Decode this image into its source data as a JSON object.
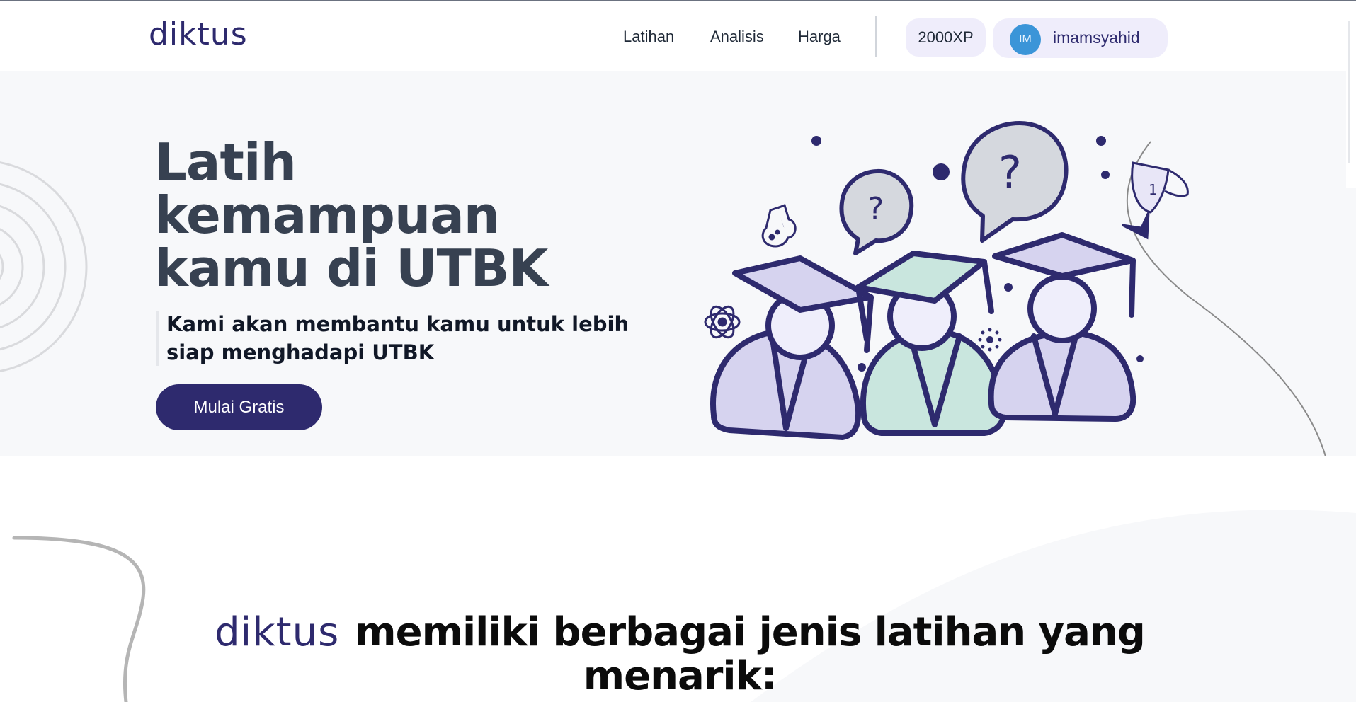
{
  "header": {
    "logo": "diktus",
    "nav": [
      "Latihan",
      "Analisis",
      "Harga"
    ],
    "xp": "2000XP",
    "user": {
      "initials": "IM",
      "name": "imamsyahid"
    }
  },
  "hero": {
    "title": "Latih kemampuan kamu di UTBK",
    "subtitle": "Kami akan membantu kamu untuk lebih siap menghadapi UTBK",
    "cta": "Mulai Gratis",
    "illustration_text": "1"
  },
  "section2": {
    "logo": "diktus",
    "title": "memiliki berbagai jenis latihan yang menarik:"
  },
  "colors": {
    "brand": "#2e2a6e",
    "hero_bg": "#f7f8fa",
    "avatar": "#3b95d8",
    "pill_bg": "#efedfb",
    "cap_lavender": "#d6d3ef",
    "cap_mint": "#c9e6de"
  }
}
